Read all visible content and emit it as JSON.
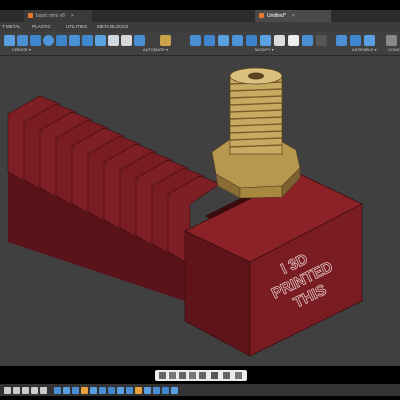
{
  "tabs": {
    "inactive_label": "basic mini v8",
    "active_label": "Untitled*",
    "close_glyph": "×"
  },
  "menu": {
    "items": [
      "T METAL",
      "PLASTIC",
      "UTILITIES",
      "META BLOCKS"
    ]
  },
  "toolbar": {
    "groups": [
      "CREATE ▾",
      "AUTOMATE ▾",
      "MODIFY ▾",
      "ASSEMBLE ▾",
      "CONS"
    ],
    "icons": [
      "sketch-icon",
      "box-icon",
      "cylinder-icon",
      "sphere-icon",
      "torus-icon",
      "coil-icon",
      "pipe-icon",
      "fillet-icon",
      "pattern-icon",
      "shell-icon",
      "automate-icon",
      "press-pull-icon",
      "draft-icon",
      "scale-icon",
      "combine-icon",
      "move-icon",
      "align-icon",
      "joint-icon",
      "rigid-group-icon",
      "drive-icon",
      "motion-link-icon"
    ]
  },
  "part": {
    "engraving_lines": [
      "I 3D",
      "PRINTED",
      "THIS"
    ]
  },
  "colors": {
    "viewport_bg": "#404040",
    "part_front": "#7a1d22",
    "part_side": "#5e1418",
    "part_top": "#8a2228",
    "brass_light": "#d4b878",
    "brass_dark": "#8a6c35",
    "accent": "#e8782a"
  }
}
